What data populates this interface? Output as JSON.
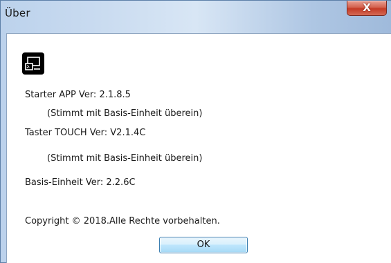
{
  "window": {
    "title": "Über",
    "close_glyph": "X",
    "close_icon": "close-icon"
  },
  "app": {
    "icon": "cast-screen-icon"
  },
  "info": {
    "starter_app": "Starter APP Ver: 2.1.8.5",
    "starter_app_note": "(Stimmt mit Basis-Einheit überein)",
    "taster_touch": "Taster TOUCH Ver: V2.1.4C",
    "taster_touch_note": "(Stimmt mit Basis-Einheit überein)",
    "basis_einheit": "Basis-Einheit Ver: 2.2.6C",
    "copyright": "Copyright © 2018.Alle Rechte vorbehalten."
  },
  "buttons": {
    "ok_label": "OK"
  },
  "colors": {
    "titlebar": "#c9dbf0",
    "close_button": "#c9452f",
    "ok_border": "#3c7fb1"
  }
}
